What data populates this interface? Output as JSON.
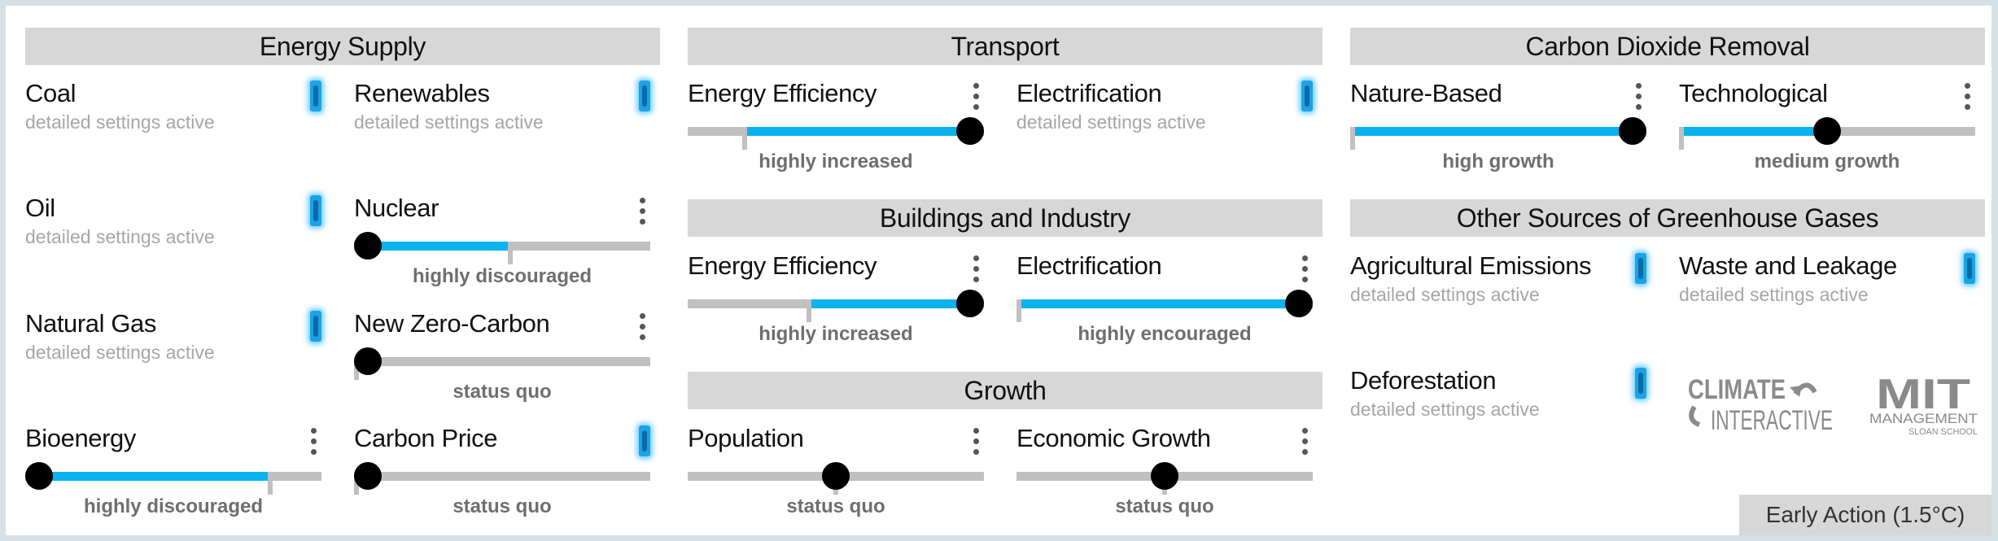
{
  "sections": {
    "energy_supply": "Energy Supply",
    "transport": "Transport",
    "buildings": "Buildings and Industry",
    "growth": "Growth",
    "cdr": "Carbon Dioxide Removal",
    "other_ghg": "Other Sources of Greenhouse Gases"
  },
  "detail_text": "detailed settings active",
  "controls": {
    "coal": {
      "label": "Coal",
      "detailed": true
    },
    "renewables": {
      "label": "Renewables",
      "detailed": true
    },
    "oil": {
      "label": "Oil",
      "detailed": true
    },
    "nuclear": {
      "label": "Nuclear",
      "status": "highly discouraged",
      "level": 0.0,
      "baseline": 0.53
    },
    "natural_gas": {
      "label": "Natural Gas",
      "detailed": true
    },
    "new_zero_carbon": {
      "label": "New Zero-Carbon",
      "status": "status quo",
      "level": 0.0,
      "baseline": 0.0
    },
    "bioenergy": {
      "label": "Bioenergy",
      "status": "highly discouraged",
      "level": 0.0,
      "baseline": 0.86
    },
    "carbon_price": {
      "label": "Carbon Price",
      "status": "status quo",
      "level": 0.0,
      "baseline": 0.0,
      "detailed": true
    },
    "transport_efficiency": {
      "label": "Energy Efficiency",
      "status": "highly increased",
      "level": 1.0,
      "baseline": 0.16
    },
    "transport_electrification": {
      "label": "Electrification",
      "detailed": true
    },
    "bi_efficiency": {
      "label": "Energy Efficiency",
      "status": "highly increased",
      "level": 1.0,
      "baseline": 0.4
    },
    "bi_electrification": {
      "label": "Electrification",
      "status": "highly encouraged",
      "level": 1.0,
      "baseline": 0.0
    },
    "population": {
      "label": "Population",
      "status": "status quo",
      "level": 0.5,
      "baseline": 0.5
    },
    "economic_growth": {
      "label": "Economic Growth",
      "status": "status quo",
      "level": 0.5,
      "baseline": 0.5
    },
    "nature_based": {
      "label": "Nature-Based",
      "status": "high growth",
      "level": 1.0,
      "baseline": 0.0
    },
    "technological": {
      "label": "Technological",
      "status": "medium growth",
      "level": 0.5,
      "baseline": 0.0
    },
    "agricultural": {
      "label": "Agricultural Emissions",
      "detailed": true
    },
    "waste": {
      "label": "Waste and Leakage",
      "detailed": true
    },
    "deforestation": {
      "label": "Deforestation",
      "detailed": true
    }
  },
  "logos": {
    "climate_interactive": [
      "CLIMATE",
      "INTERACTIVE"
    ],
    "mit": [
      "MIT",
      "MANAGEMENT",
      "SLOAN SCHOOL"
    ]
  },
  "scenario_label": "Early Action (1.5°C)",
  "colors": {
    "accent": "#0ab3f0",
    "track": "#c0c0c0",
    "knob": "#000000",
    "header_bg": "#d7d7d7"
  }
}
